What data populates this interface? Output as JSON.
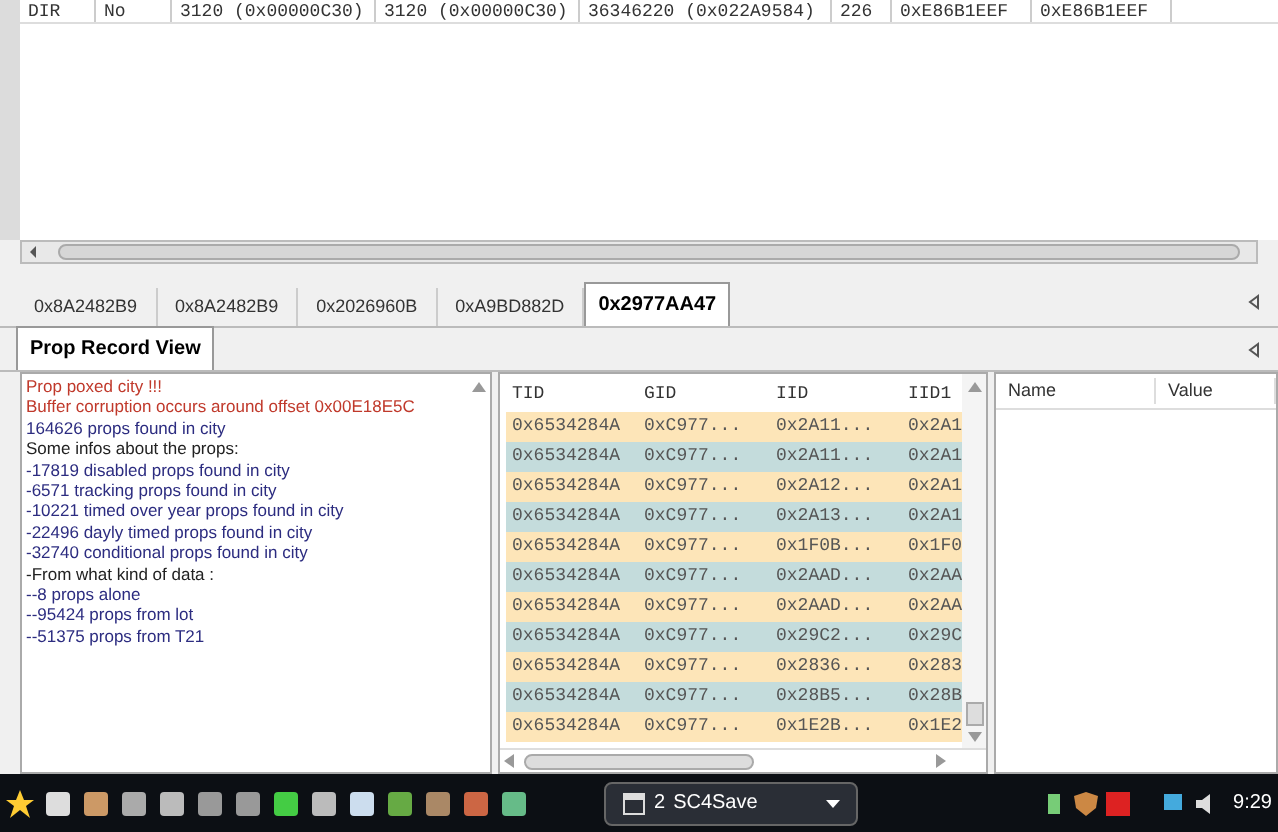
{
  "top_table": {
    "row": [
      "DIR",
      "No",
      "3120 (0x00000C30)",
      "3120 (0x00000C30)",
      "36346220 (0x022A9584)",
      "226",
      "0xE86B1EEF",
      "0xE86B1EEF"
    ]
  },
  "file_tabs": [
    {
      "label": "0x8A2482B9",
      "selected": false
    },
    {
      "label": "0x8A2482B9",
      "selected": false
    },
    {
      "label": "0x2026960B",
      "selected": false
    },
    {
      "label": "0xA9BD882D",
      "selected": false
    },
    {
      "label": "0x2977AA47",
      "selected": true
    }
  ],
  "view_tabs": [
    {
      "label": "Prop Record View",
      "selected": true
    }
  ],
  "log": [
    {
      "kind": "error",
      "text": "Prop poxed city !!!"
    },
    {
      "kind": "error",
      "text": "Buffer corruption occurs around offset 0x00E18E5C"
    },
    {
      "kind": "info",
      "text": "164626 props found in city"
    },
    {
      "kind": "plain",
      "text": "Some infos about the props:"
    },
    {
      "kind": "info",
      "text": "-17819 disabled props found in city"
    },
    {
      "kind": "info",
      "text": "-6571 tracking props found in city"
    },
    {
      "kind": "info",
      "text": "-10221 timed over year props found in city"
    },
    {
      "kind": "info",
      "text": "-22496 dayly timed props found in city"
    },
    {
      "kind": "info",
      "text": "-32740 conditional props found in city"
    },
    {
      "kind": "plain",
      "text": "-From what kind of data :"
    },
    {
      "kind": "info",
      "text": "--8 props alone"
    },
    {
      "kind": "info",
      "text": "--95424 props from lot"
    },
    {
      "kind": "info",
      "text": "--51375 props from T21"
    }
  ],
  "grid": {
    "columns": [
      "TID",
      "GID",
      "IID",
      "IID1"
    ],
    "rows": [
      [
        "0x6534284A",
        "0xC977...",
        "0x2A11...",
        "0x2A1"
      ],
      [
        "0x6534284A",
        "0xC977...",
        "0x2A11...",
        "0x2A1"
      ],
      [
        "0x6534284A",
        "0xC977...",
        "0x2A12...",
        "0x2A1"
      ],
      [
        "0x6534284A",
        "0xC977...",
        "0x2A13...",
        "0x2A1"
      ],
      [
        "0x6534284A",
        "0xC977...",
        "0x1F0B...",
        "0x1F0"
      ],
      [
        "0x6534284A",
        "0xC977...",
        "0x2AAD...",
        "0x2AA"
      ],
      [
        "0x6534284A",
        "0xC977...",
        "0x2AAD...",
        "0x2AA"
      ],
      [
        "0x6534284A",
        "0xC977...",
        "0x29C2...",
        "0x29C"
      ],
      [
        "0x6534284A",
        "0xC977...",
        "0x2836...",
        "0x283"
      ],
      [
        "0x6534284A",
        "0xC977...",
        "0x28B5...",
        "0x28B"
      ],
      [
        "0x6534284A",
        "0xC977...",
        "0x1E2B...",
        "0x1E2"
      ]
    ]
  },
  "properties": {
    "columns": [
      "Name",
      "Value"
    ]
  },
  "taskbar": {
    "window_button": {
      "badge": "2",
      "label": "SC4Save"
    },
    "clock": "9:29"
  }
}
